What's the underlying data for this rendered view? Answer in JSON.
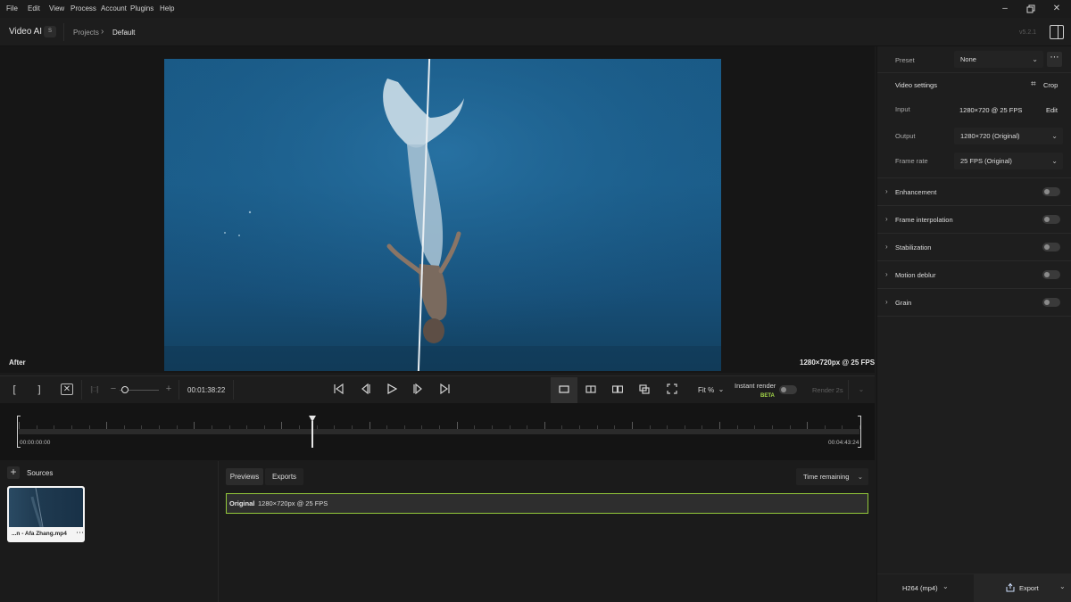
{
  "menu": {
    "items": [
      "File",
      "Edit",
      "View",
      "Process",
      "Account",
      "Plugins",
      "Help"
    ]
  },
  "window_controls": {
    "minimize_icon": "minimize-icon",
    "restore_icon": "restore-icon",
    "close_icon": "close-icon"
  },
  "header": {
    "app_title": "Video AI",
    "app_badge": "S",
    "breadcrumb": [
      "Projects",
      "Default"
    ],
    "version": "v5.2.1"
  },
  "viewer": {
    "after_label": "After",
    "resolution_label": "1280×720px @ 25 FPS"
  },
  "controls": {
    "timecode": "00:01:38:22",
    "zoom_label": "Fit %",
    "instant_render_label": "Instant render",
    "instant_render_badge": "BETA",
    "render_label": "Render 2s"
  },
  "timeline": {
    "start_time": "00:00:00:00",
    "end_time": "00:04:43:24",
    "playhead_position": 0.3495
  },
  "sources": {
    "label": "Sources",
    "items": [
      {
        "name": "...n - Afa Zhang.mp4"
      }
    ]
  },
  "previews": {
    "tabs": [
      {
        "label": "Previews",
        "active": true
      },
      {
        "label": "Exports",
        "active": false
      }
    ],
    "sort_label": "Time remaining",
    "rows": [
      {
        "label": "Original",
        "info": "1280×720px @ 25 FPS"
      }
    ]
  },
  "panel": {
    "preset_label": "Preset",
    "preset_value": "None",
    "video_settings_label": "Video settings",
    "crop_label": "Crop",
    "input_label": "Input",
    "input_value": "1280×720 @ 25 FPS",
    "edit_label": "Edit",
    "output_label": "Output",
    "output_value": "1280×720 (Original)",
    "frame_rate_label": "Frame rate",
    "frame_rate_value": "25 FPS (Original)",
    "sections": [
      {
        "label": "Enhancement",
        "enabled": false
      },
      {
        "label": "Frame interpolation",
        "enabled": false
      },
      {
        "label": "Stabilization",
        "enabled": false
      },
      {
        "label": "Motion deblur",
        "enabled": false
      },
      {
        "label": "Grain",
        "enabled": false
      }
    ],
    "format_label": "H264 (mp4)",
    "export_label": "Export"
  },
  "colors": {
    "accent_green": "#93c83a",
    "beta_green": "#a6d94a",
    "background": "#1b1b1b",
    "video_blue": "#1b5d8a"
  }
}
